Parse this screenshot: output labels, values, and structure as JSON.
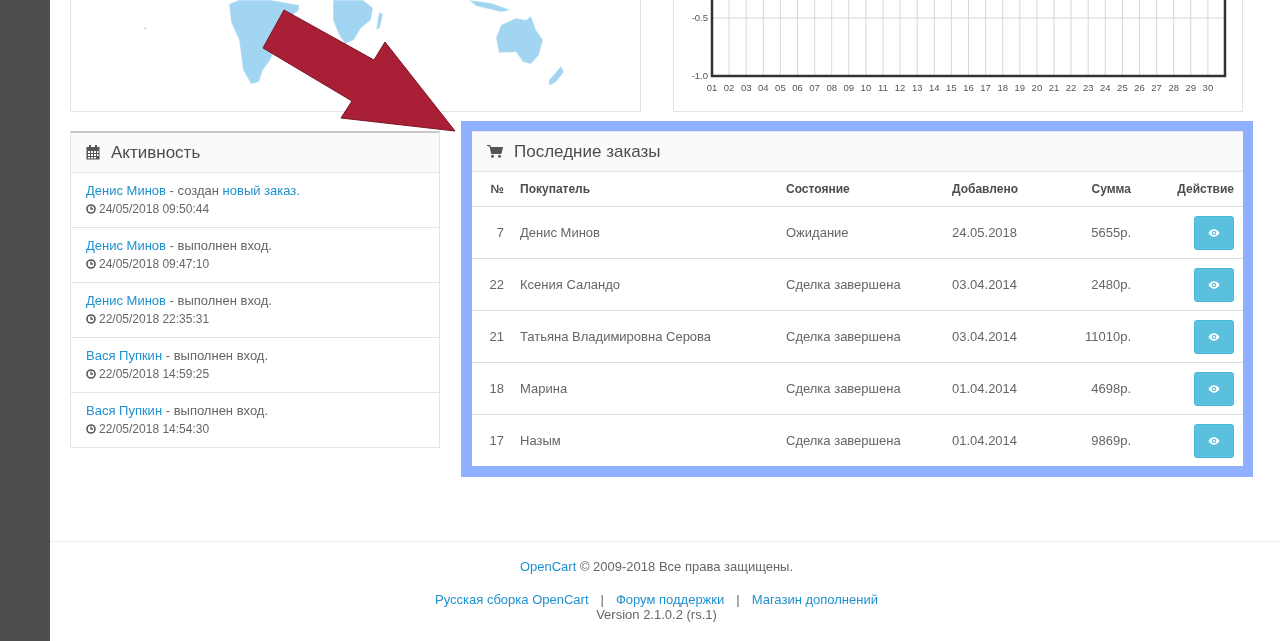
{
  "chart_panel": {
    "chart_data": {
      "type": "line",
      "categories": [
        "01",
        "02",
        "03",
        "04",
        "05",
        "06",
        "07",
        "08",
        "09",
        "10",
        "11",
        "12",
        "13",
        "14",
        "15",
        "16",
        "17",
        "18",
        "19",
        "20",
        "21",
        "22",
        "23",
        "24",
        "25",
        "26",
        "27",
        "28",
        "29",
        "30"
      ],
      "grid": true,
      "ylim": [
        -1.0,
        -0.345
      ],
      "yticks": [
        {
          "value": -1.0,
          "label": "-1.0"
        },
        {
          "value": -0.5,
          "label": "-0.5"
        }
      ]
    }
  },
  "activity": {
    "title": "Активность",
    "items": [
      {
        "parts": [
          {
            "text": "Денис Минов",
            "link": true
          },
          {
            "text": " - создан ",
            "link": false
          },
          {
            "text": "новый заказ.",
            "link": true
          }
        ],
        "time": "24/05/2018 09:50:44"
      },
      {
        "parts": [
          {
            "text": "Денис Минов",
            "link": true
          },
          {
            "text": " - выполнен вход.",
            "link": false
          }
        ],
        "time": "24/05/2018 09:47:10"
      },
      {
        "parts": [
          {
            "text": "Денис Минов",
            "link": true
          },
          {
            "text": " - выполнен вход.",
            "link": false
          }
        ],
        "time": "22/05/2018 22:35:31"
      },
      {
        "parts": [
          {
            "text": "Вася Пупкин",
            "link": true
          },
          {
            "text": " - выполнен вход.",
            "link": false
          }
        ],
        "time": "22/05/2018 14:59:25"
      },
      {
        "parts": [
          {
            "text": "Вася Пупкин",
            "link": true
          },
          {
            "text": " - выполнен вход.",
            "link": false
          }
        ],
        "time": "22/05/2018 14:54:30"
      }
    ]
  },
  "latest_orders": {
    "title": "Последние заказы",
    "columns": [
      "№",
      "Покупатель",
      "Состояние",
      "Добавлено",
      "Сумма",
      "Действие"
    ],
    "rows": [
      {
        "number": "7",
        "customer": "Денис Минов",
        "status": "Ожидание",
        "added": "24.05.2018",
        "total": "5655р."
      },
      {
        "number": "22",
        "customer": "Ксения Саландо",
        "status": "Сделка завершена",
        "added": "03.04.2014",
        "total": "2480р."
      },
      {
        "number": "21",
        "customer": "Татьяна Владимировна Серова",
        "status": "Сделка завершена",
        "added": "03.04.2014",
        "total": "11010р."
      },
      {
        "number": "18",
        "customer": "Марина",
        "status": "Сделка завершена",
        "added": "01.04.2014",
        "total": "4698р."
      },
      {
        "number": "17",
        "customer": "Назым",
        "status": "Сделка завершена",
        "added": "01.04.2014",
        "total": "9869р."
      }
    ]
  },
  "footer": {
    "brand_link": "OpenCart",
    "copyright": "© 2009-2018 Все права защищены.",
    "links": [
      "Русская сборка OpenCart",
      "Форум поддержки",
      "Магазин дополнений"
    ],
    "separators": [
      "|",
      "|"
    ],
    "version": "Version 2.1.0.2 (rs.1)"
  }
}
